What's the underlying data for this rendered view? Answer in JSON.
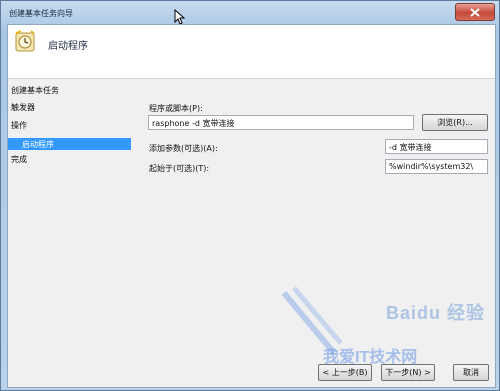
{
  "window": {
    "title": "创建基本任务向导",
    "close_icon": "close-icon"
  },
  "header": {
    "icon": "clock-task-icon",
    "title": "启动程序"
  },
  "sidebar": {
    "heading": "创建基本任务",
    "items": [
      {
        "label": "触发器",
        "selected": false
      },
      {
        "label": "操作",
        "selected": false
      },
      {
        "label": "启动程序",
        "selected": true
      },
      {
        "label": "完成",
        "selected": false
      }
    ],
    "selected_color": "#3399ff"
  },
  "form": {
    "program_label": "程序或脚本(P):",
    "program_value": "rasphone -d 宽带连接",
    "browse_label": "浏览(R)...",
    "args_label": "添加参数(可选)(A):",
    "args_value": "-d 宽带连接",
    "start_in_label": "起始于(可选)(T):",
    "start_in_value": "%windir%\\system32\\"
  },
  "footer": {
    "back_label": "< 上一步(B)",
    "next_label": "下一步(N) >",
    "cancel_label": "取消"
  },
  "watermark": {
    "line1": "Baidu 经验",
    "line2": "我爱IT技术网"
  }
}
